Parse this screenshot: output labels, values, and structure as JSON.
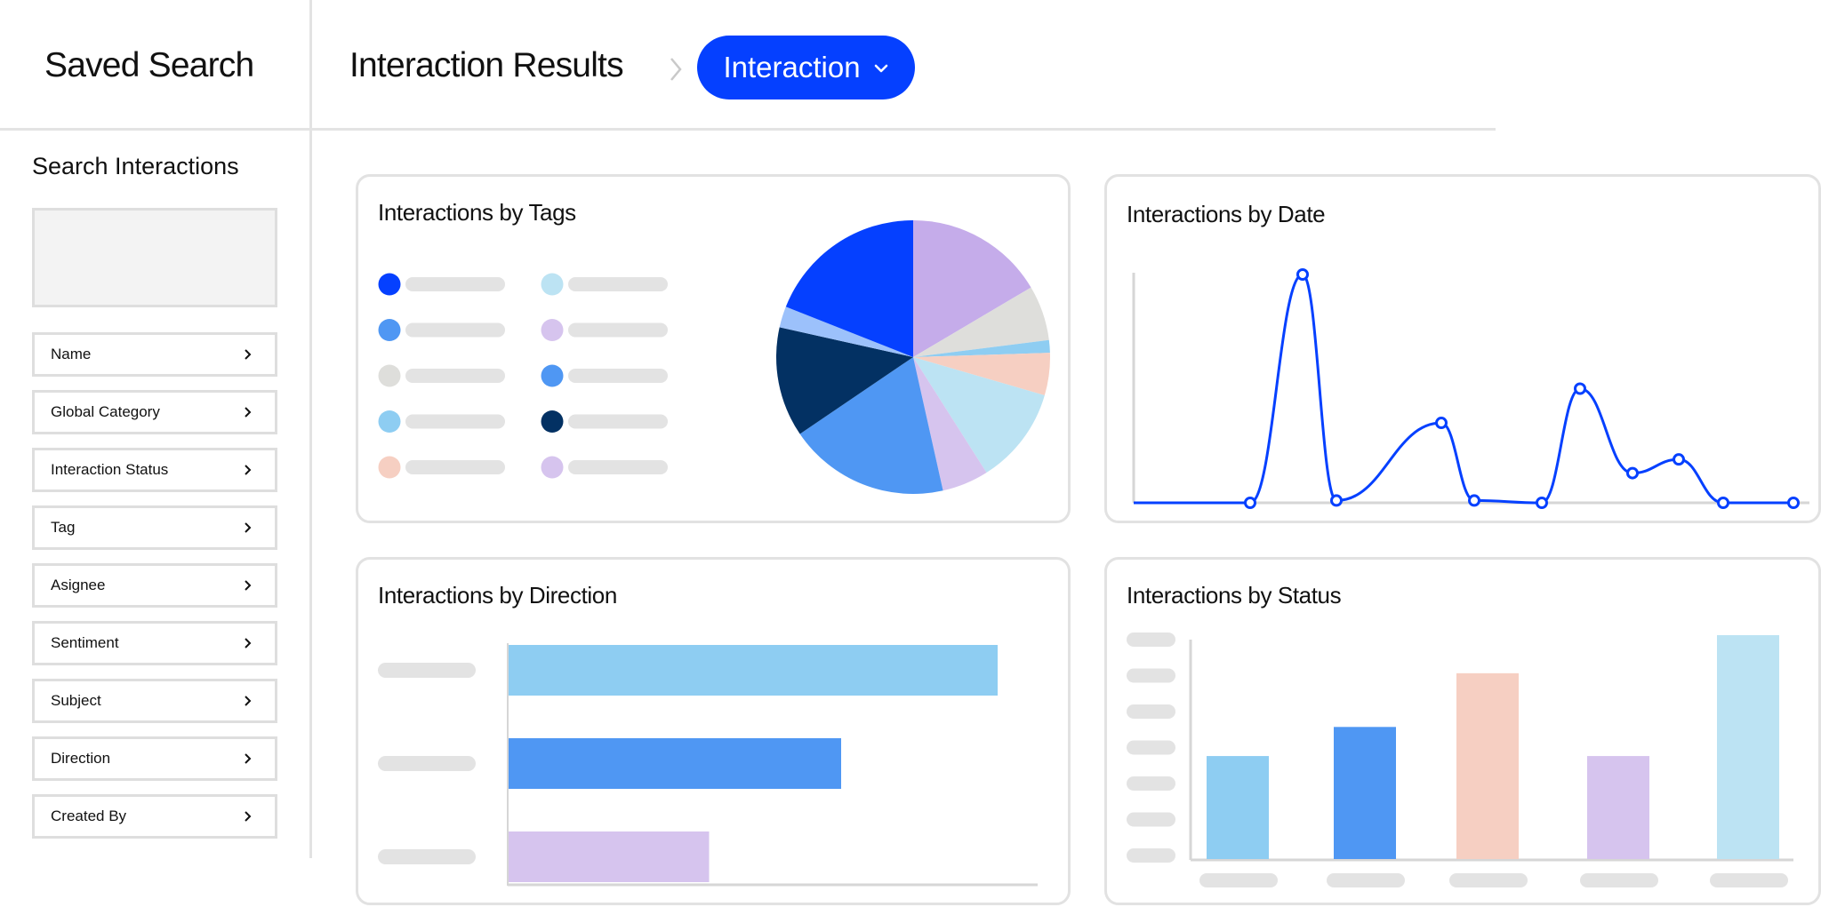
{
  "header": {
    "app_title": "Saved Search",
    "page_title": "Interaction Results",
    "dropdown_label": "Interaction"
  },
  "sidebar": {
    "title": "Search Interactions",
    "filters": [
      {
        "label": "Name"
      },
      {
        "label": "Global Category"
      },
      {
        "label": "Interaction Status"
      },
      {
        "label": "Tag"
      },
      {
        "label": "Asignee"
      },
      {
        "label": "Sentiment"
      },
      {
        "label": "Subject"
      },
      {
        "label": "Direction"
      },
      {
        "label": "Created By"
      }
    ]
  },
  "colors": {
    "accent": "#0540ff",
    "navy": "#033163",
    "mid_blue": "#4f97f3",
    "light_blue": "#8ecdf2",
    "pale_blue": "#bce3f3",
    "periwinkle": "#9cc1fb",
    "lavender": "#c5acea",
    "pale_lavender": "#d6c4ee",
    "peach": "#f6cfc2",
    "light_gray": "#dededb",
    "placeholder": "#e3e3e3"
  },
  "cards": {
    "tags": {
      "title": "Interactions by Tags"
    },
    "date": {
      "title": "Interactions by Date"
    },
    "direction": {
      "title": "Interactions by Direction"
    },
    "status": {
      "title": "Interactions by Status"
    }
  },
  "chart_data": [
    {
      "type": "pie",
      "title": "Interactions by Tags",
      "values": [
        16.5,
        6.5,
        1.5,
        5,
        11.5,
        5.5,
        19,
        13,
        2.5,
        19
      ],
      "colors": [
        "#c5acea",
        "#dededb",
        "#8ecdf2",
        "#f6cfc2",
        "#bce3f3",
        "#d6c4ee",
        "#4f97f3",
        "#033163",
        "#9cc1fb",
        "#0540ff"
      ],
      "legend_colors": [
        "#0540ff",
        "#4f97f3",
        "#dededb",
        "#8ecdf2",
        "#f6cfc2",
        "#bce3f3",
        "#d6c4ee",
        "#4f97f3",
        "#033163",
        "#d6c4ee"
      ]
    },
    {
      "type": "line",
      "title": "Interactions by Date",
      "x": [
        0,
        1,
        2,
        3,
        4,
        5,
        6,
        7,
        8,
        9,
        10,
        11
      ],
      "series": [
        {
          "values": [
            0,
            0,
            100,
            1,
            35,
            1,
            0,
            50,
            13,
            19,
            0,
            0
          ]
        }
      ],
      "markers_at": [
        1,
        2,
        3,
        4,
        5,
        6,
        7,
        8,
        9,
        10,
        11
      ],
      "ylim": [
        0,
        100
      ],
      "color": "#0540ff"
    },
    {
      "type": "bar",
      "orientation": "horizontal",
      "title": "Interactions by Direction",
      "values": [
        100,
        68,
        41
      ],
      "colors": [
        "#8ecdf2",
        "#4f97f3",
        "#d6c4ee"
      ],
      "xlim": [
        0,
        110
      ]
    },
    {
      "type": "bar",
      "title": "Interactions by Status",
      "values": [
        46,
        59,
        83,
        46,
        100
      ],
      "colors": [
        "#8ecdf2",
        "#4f97f3",
        "#f6cfc2",
        "#d6c4ee",
        "#bce3f3"
      ],
      "ylim": [
        0,
        100
      ]
    }
  ]
}
